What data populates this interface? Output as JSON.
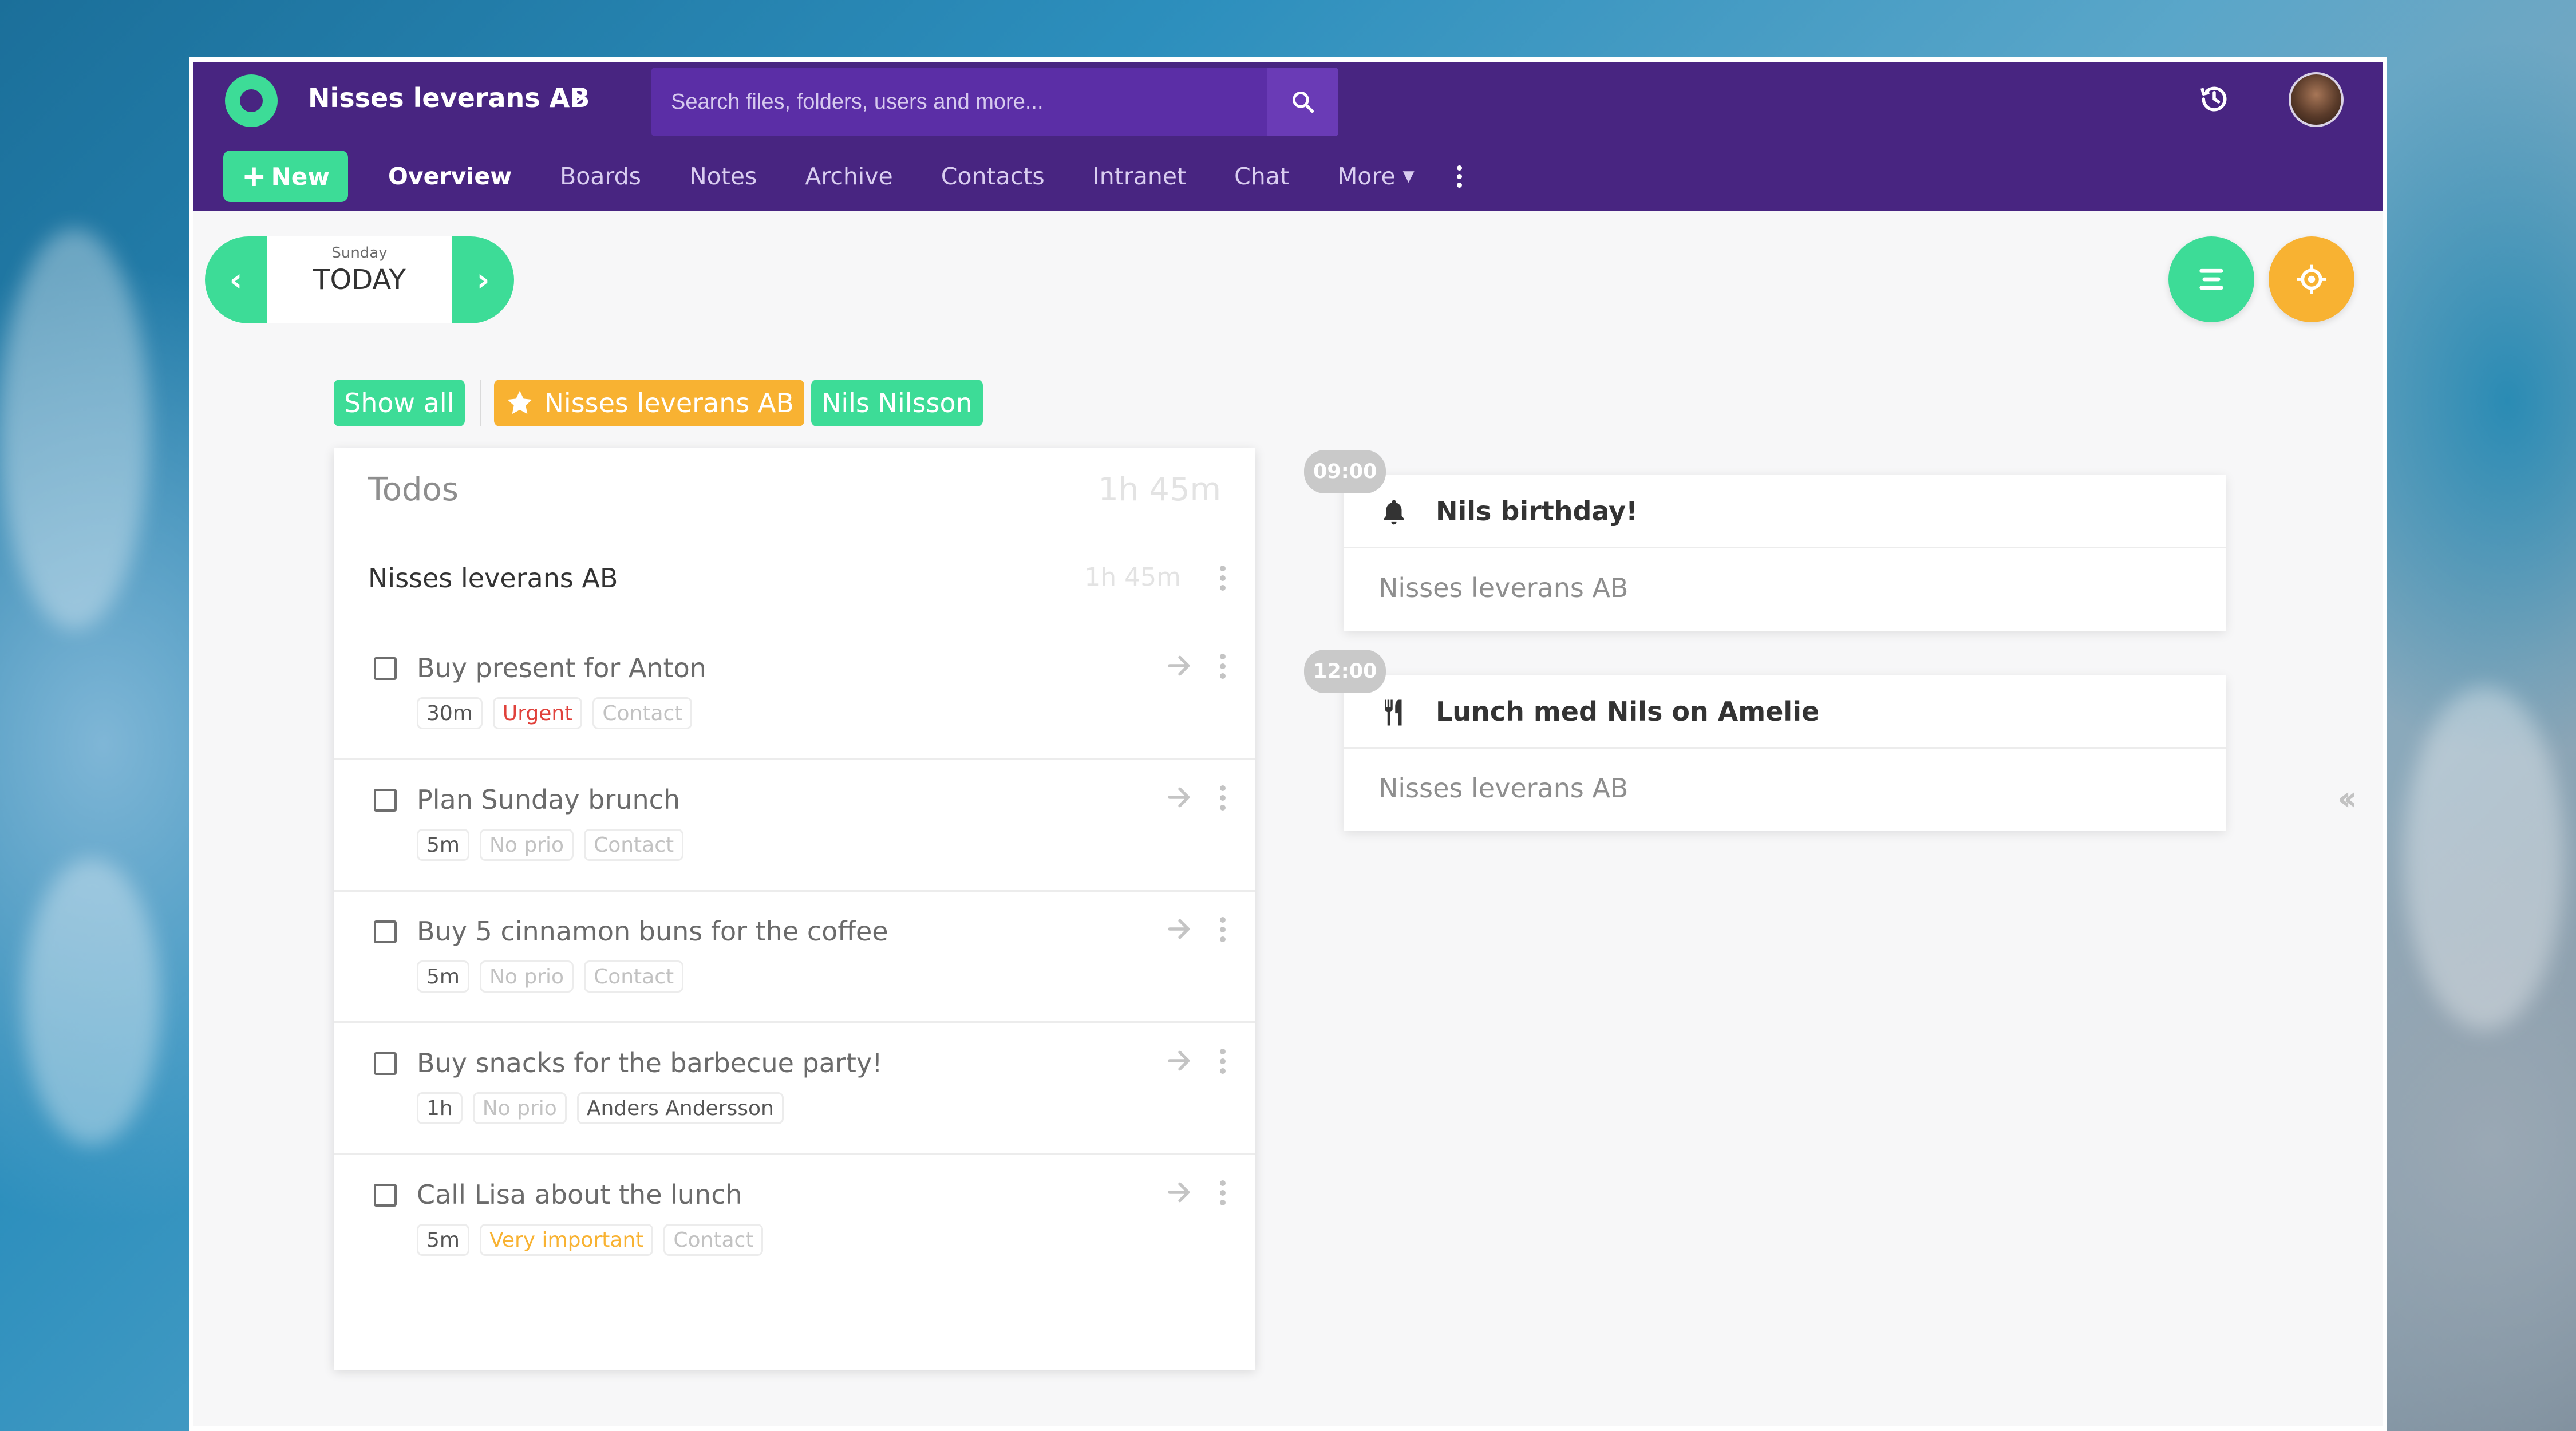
{
  "header": {
    "org_name": "Nisses leverans AB",
    "search_placeholder": "Search files, folders, users and more...",
    "new_label": "New",
    "nav": [
      {
        "label": "Overview"
      },
      {
        "label": "Boards"
      },
      {
        "label": "Notes"
      },
      {
        "label": "Archive"
      },
      {
        "label": "Contacts"
      },
      {
        "label": "Intranet"
      },
      {
        "label": "Chat"
      },
      {
        "label": "More"
      }
    ]
  },
  "date_nav": {
    "weekday": "Sunday",
    "label": "TODAY"
  },
  "filters": {
    "show_all": "Show all",
    "company": "Nisses leverans AB",
    "person": "Nils Nilsson"
  },
  "todos": {
    "title": "Todos",
    "total": "1h 45m",
    "group": {
      "title": "Nisses leverans AB",
      "total": "1h 45m"
    },
    "items": [
      {
        "text": "Buy present for Anton",
        "duration": "30m",
        "priority": "Urgent",
        "contact": "Contact"
      },
      {
        "text": "Plan Sunday brunch",
        "duration": "5m",
        "priority": "No prio",
        "contact": "Contact"
      },
      {
        "text": "Buy 5 cinnamon buns for the coffee",
        "duration": "5m",
        "priority": "No prio",
        "contact": "Contact"
      },
      {
        "text": "Buy snacks for the barbecue party!",
        "duration": "1h",
        "priority": "No prio",
        "contact": "Anders Andersson"
      },
      {
        "text": "Call Lisa about the lunch",
        "duration": "5m",
        "priority": "Very important",
        "contact": "Contact"
      }
    ]
  },
  "events": [
    {
      "time": "09:00",
      "title": "Nils birthday!",
      "org": "Nisses leverans AB",
      "icon": "bell-icon"
    },
    {
      "time": "12:00",
      "title": "Lunch med Nils on Amelie",
      "org": "Nisses leverans AB",
      "icon": "utensils-icon"
    }
  ],
  "colors": {
    "brand_purple": "#482581",
    "accent_green": "#3ddc97",
    "accent_orange": "#f8b232",
    "urgent_red": "#e0413b"
  }
}
